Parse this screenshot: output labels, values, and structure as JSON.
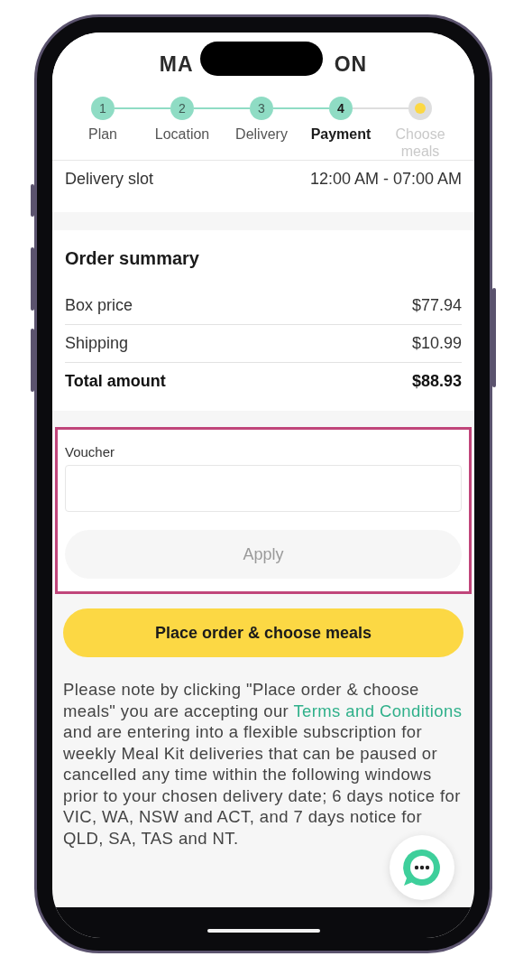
{
  "header": {
    "logo_left": "MA",
    "logo_right": "ON"
  },
  "steps": [
    {
      "number": "1",
      "label": "Plan",
      "done": true,
      "selected": false
    },
    {
      "number": "2",
      "label": "Location",
      "done": true,
      "selected": false
    },
    {
      "number": "3",
      "label": "Delivery",
      "done": true,
      "selected": false
    },
    {
      "number": "4",
      "label": "Payment",
      "done": false,
      "selected": true
    },
    {
      "label": "Choose meals",
      "done": false,
      "selected": false
    }
  ],
  "delivery": {
    "label": "Delivery slot",
    "value": "12:00 AM - 07:00 AM"
  },
  "order_summary": {
    "title": "Order summary",
    "rows": [
      {
        "label": "Box price",
        "value": "$77.94",
        "kind": "item"
      },
      {
        "label": "Shipping",
        "value": "$10.99",
        "kind": "item"
      },
      {
        "label": "Total amount",
        "value": "$88.93",
        "kind": "total"
      }
    ]
  },
  "voucher": {
    "label": "Voucher",
    "highlighted": true,
    "apply_button": {
      "label": "Apply",
      "disabled": true
    }
  },
  "place_order_button": "Place order & choose meals",
  "notice": {
    "before": "Please note by clicking \"Place order & choose meals\" you are accepting our",
    "link": "Terms and Conditions",
    "after": "and are entering into a flexible subscription for weekly Meal Kit deliveries that can be paused or cancelled any time within the following windows prior to your chosen delivery date; 6 days notice for VIC, WA, NSW and ACT, and 7 days notice for QLD, SA, TAS and NT."
  }
}
